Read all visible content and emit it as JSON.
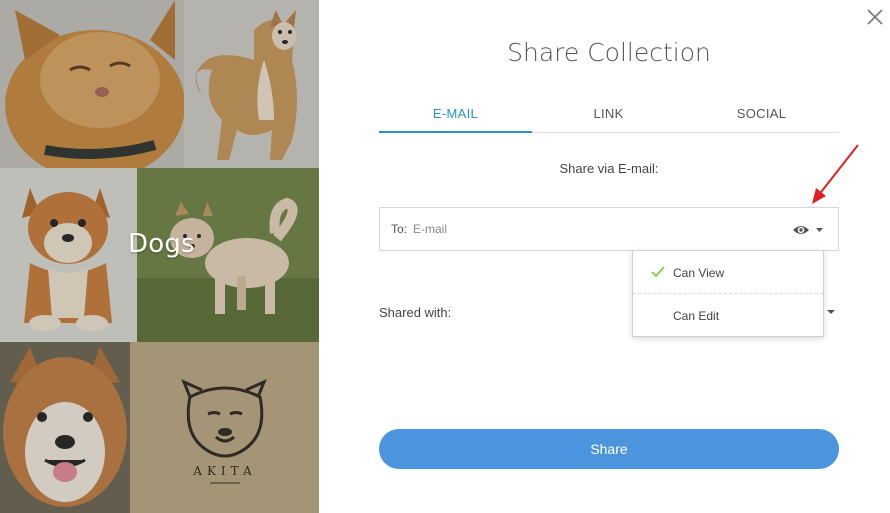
{
  "collection": {
    "name": "Dogs",
    "logo_text": "AKITA"
  },
  "dialog": {
    "title": "Share Collection",
    "tabs": [
      {
        "label": "E-MAIL",
        "active": true
      },
      {
        "label": "LINK",
        "active": false
      },
      {
        "label": "SOCIAL",
        "active": false
      }
    ],
    "subheading": "Share via E-mail:",
    "email": {
      "to_label": "To:",
      "placeholder": "E-mail",
      "value": ""
    },
    "permission_menu": {
      "items": [
        {
          "label": "Can View",
          "checked": true
        },
        {
          "label": "Can Edit",
          "checked": false
        }
      ]
    },
    "shared_with_label": "Shared with:",
    "share_button": "Share"
  },
  "icons": {
    "close": "close-icon",
    "permission": "eye-icon",
    "caret": "caret-down-icon",
    "check": "check-icon"
  },
  "colors": {
    "accent": "#2a8fd0",
    "button": "#4a95de",
    "check": "#8bc34a",
    "annotation_arrow": "#e02020"
  }
}
